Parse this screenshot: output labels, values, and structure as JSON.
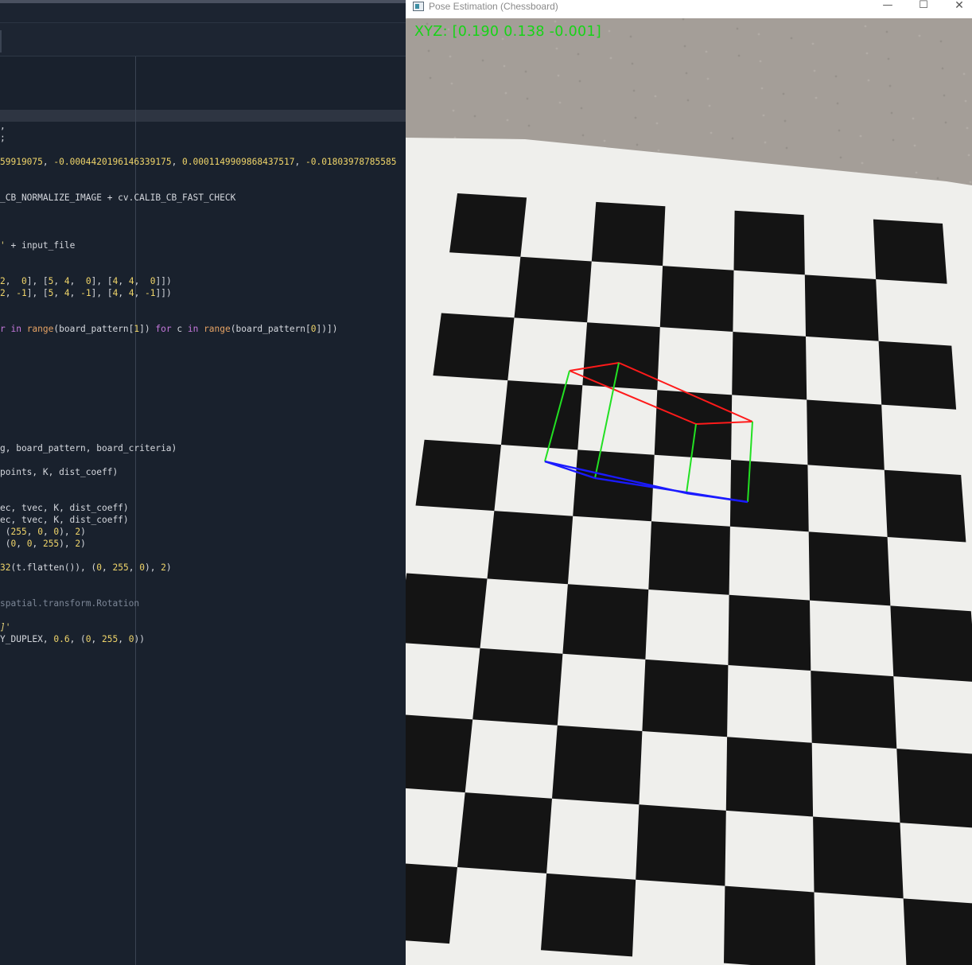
{
  "editor": {
    "lines": [
      [
        [
          "w",
          ","
        ]
      ],
      [
        [
          "w",
          ";"
        ]
      ],
      [
        [
          "n",
          "59919075"
        ],
        [
          "w",
          ", "
        ],
        [
          "n",
          "-0.0004420196146339175"
        ],
        [
          "w",
          ", "
        ],
        [
          "n",
          "0.0001149909868437517"
        ],
        [
          "w",
          ", "
        ],
        [
          "n",
          "-0.01803978785585"
        ]
      ],
      [
        [
          "w",
          "_CB_NORMALIZE_IMAGE + cv.CALIB_CB_FAST_CHECK"
        ]
      ],
      [
        [
          "s",
          "'"
        ],
        [
          "w",
          " + input_file"
        ]
      ],
      [
        [
          "n",
          "2"
        ],
        [
          "w",
          ",  "
        ],
        [
          "n",
          "0"
        ],
        [
          "w",
          "], ["
        ],
        [
          "n",
          "5"
        ],
        [
          "w",
          ", "
        ],
        [
          "n",
          "4"
        ],
        [
          "w",
          ",  "
        ],
        [
          "n",
          "0"
        ],
        [
          "w",
          "], ["
        ],
        [
          "n",
          "4"
        ],
        [
          "w",
          ", "
        ],
        [
          "n",
          "4"
        ],
        [
          "w",
          ",  "
        ],
        [
          "n",
          "0"
        ],
        [
          "w",
          "]])"
        ]
      ],
      [
        [
          "n",
          "2"
        ],
        [
          "w",
          ", "
        ],
        [
          "n",
          "-1"
        ],
        [
          "w",
          "], ["
        ],
        [
          "n",
          "5"
        ],
        [
          "w",
          ", "
        ],
        [
          "n",
          "4"
        ],
        [
          "w",
          ", "
        ],
        [
          "n",
          "-1"
        ],
        [
          "w",
          "], ["
        ],
        [
          "n",
          "4"
        ],
        [
          "w",
          ", "
        ],
        [
          "n",
          "4"
        ],
        [
          "w",
          ", "
        ],
        [
          "n",
          "-1"
        ],
        [
          "w",
          "]])"
        ]
      ],
      [
        [
          "k",
          "r in "
        ],
        [
          "f",
          "range"
        ],
        [
          "w",
          "(board_pattern["
        ],
        [
          "n",
          "1"
        ],
        [
          "w",
          "]) "
        ],
        [
          "k",
          "for"
        ],
        [
          "w",
          " c "
        ],
        [
          "k",
          "in"
        ],
        [
          "w",
          " "
        ],
        [
          "f",
          "range"
        ],
        [
          "w",
          "(board_pattern["
        ],
        [
          "n",
          "0"
        ],
        [
          "w",
          "])])"
        ]
      ],
      [
        [
          "w",
          "g, board_pattern, board_criteria)"
        ]
      ],
      [
        [
          "w",
          "points, K, dist_coeff)"
        ]
      ],
      [
        [
          "w",
          "ec, tvec, K, dist_coeff)"
        ]
      ],
      [
        [
          "w",
          "ec, tvec, K, dist_coeff)"
        ]
      ],
      [
        [
          "w",
          " ("
        ],
        [
          "n",
          "255"
        ],
        [
          "w",
          ", "
        ],
        [
          "n",
          "0"
        ],
        [
          "w",
          ", "
        ],
        [
          "n",
          "0"
        ],
        [
          "w",
          "), "
        ],
        [
          "n",
          "2"
        ],
        [
          "w",
          ")"
        ]
      ],
      [
        [
          "w",
          " ("
        ],
        [
          "n",
          "0"
        ],
        [
          "w",
          ", "
        ],
        [
          "n",
          "0"
        ],
        [
          "w",
          ", "
        ],
        [
          "n",
          "255"
        ],
        [
          "w",
          "), "
        ],
        [
          "n",
          "2"
        ],
        [
          "w",
          ")"
        ]
      ],
      [
        [
          "n",
          "32"
        ],
        [
          "w",
          "(t.flatten()), ("
        ],
        [
          "n",
          "0"
        ],
        [
          "w",
          ", "
        ],
        [
          "n",
          "255"
        ],
        [
          "w",
          ", "
        ],
        [
          "n",
          "0"
        ],
        [
          "w",
          "), "
        ],
        [
          "n",
          "2"
        ],
        [
          "w",
          ")"
        ]
      ],
      [
        [
          "c",
          "spatial.transform.Rotation"
        ]
      ],
      [
        [
          "s",
          "]'"
        ]
      ],
      [
        [
          "w",
          "Y_DUPLEX, "
        ],
        [
          "n",
          "0.6"
        ],
        [
          "w",
          ", ("
        ],
        [
          "n",
          "0"
        ],
        [
          "w",
          ", "
        ],
        [
          "n",
          "255"
        ],
        [
          "w",
          ", "
        ],
        [
          "n",
          "0"
        ],
        [
          "w",
          "))"
        ]
      ]
    ]
  },
  "window": {
    "title": "Pose Estimation (Chessboard)",
    "minimize_glyph": "—",
    "maximize_glyph": "☐",
    "close_glyph": "✕",
    "icon": "app-window-icon"
  },
  "overlay": {
    "xyz_text": "XYZ: [0.190 0.138 -0.001]",
    "colors": {
      "top_face": "#ff1a1a",
      "vertical_edges": "#22e022",
      "base_face": "#1a1aff",
      "text": "#16d416"
    }
  }
}
